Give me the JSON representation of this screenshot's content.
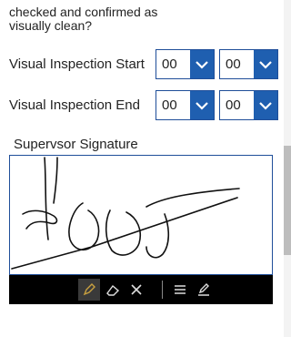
{
  "question": {
    "line1": "checked and confirmed as",
    "line2": "visually clean?"
  },
  "inspection_start": {
    "label": "Visual Inspection Start",
    "hour": "00",
    "minute": "00"
  },
  "inspection_end": {
    "label": "Visual Inspection End",
    "hour": "00",
    "minute": "00"
  },
  "signature": {
    "label": "Supervsor Signature"
  },
  "colors": {
    "accent": "#1f5fb0",
    "border": "#1f4e99",
    "toolbar": "#000000"
  },
  "toolbar_icons": [
    "pen-icon",
    "eraser-icon",
    "clear-icon",
    "menu-icon",
    "edit-icon"
  ]
}
